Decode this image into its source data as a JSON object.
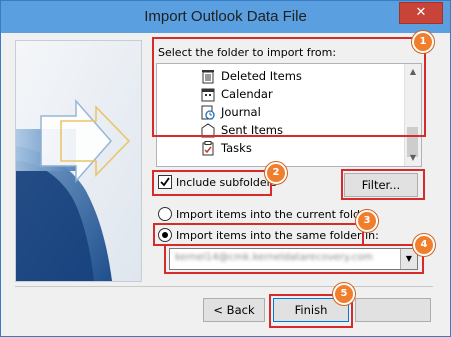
{
  "window": {
    "title": "Import Outlook Data File",
    "close_glyph": "✕"
  },
  "folder_section": {
    "label": "Select the folder to import from:"
  },
  "folder_list": {
    "items": [
      {
        "label": "Deleted Items",
        "icon": "trash-icon"
      },
      {
        "label": "Calendar",
        "icon": "calendar-icon"
      },
      {
        "label": "Journal",
        "icon": "journal-icon"
      },
      {
        "label": "Sent Items",
        "icon": "sent-items-icon"
      },
      {
        "label": "Tasks",
        "icon": "tasks-icon"
      }
    ]
  },
  "options": {
    "include_subfolders": {
      "label": "Include subfolders",
      "checked": true
    },
    "filter_button": "Filter...",
    "radio_current": {
      "label": "Import items into the current folder",
      "selected": false
    },
    "radio_same": {
      "label": "Import items into the same folder in:",
      "selected": true
    },
    "target_account": "kernel14@cmk.kerneldatarecovery.com"
  },
  "footer": {
    "back_button": "< Back",
    "finish_button": "Finish"
  },
  "annotations": {
    "n1": "1",
    "n2": "2",
    "n3": "3",
    "n4": "4",
    "n5": "5"
  },
  "colors": {
    "titlebar": "#5a9fe0",
    "close": "#c94438",
    "highlight": "#d72a2a",
    "badge": "#f07e2d"
  }
}
